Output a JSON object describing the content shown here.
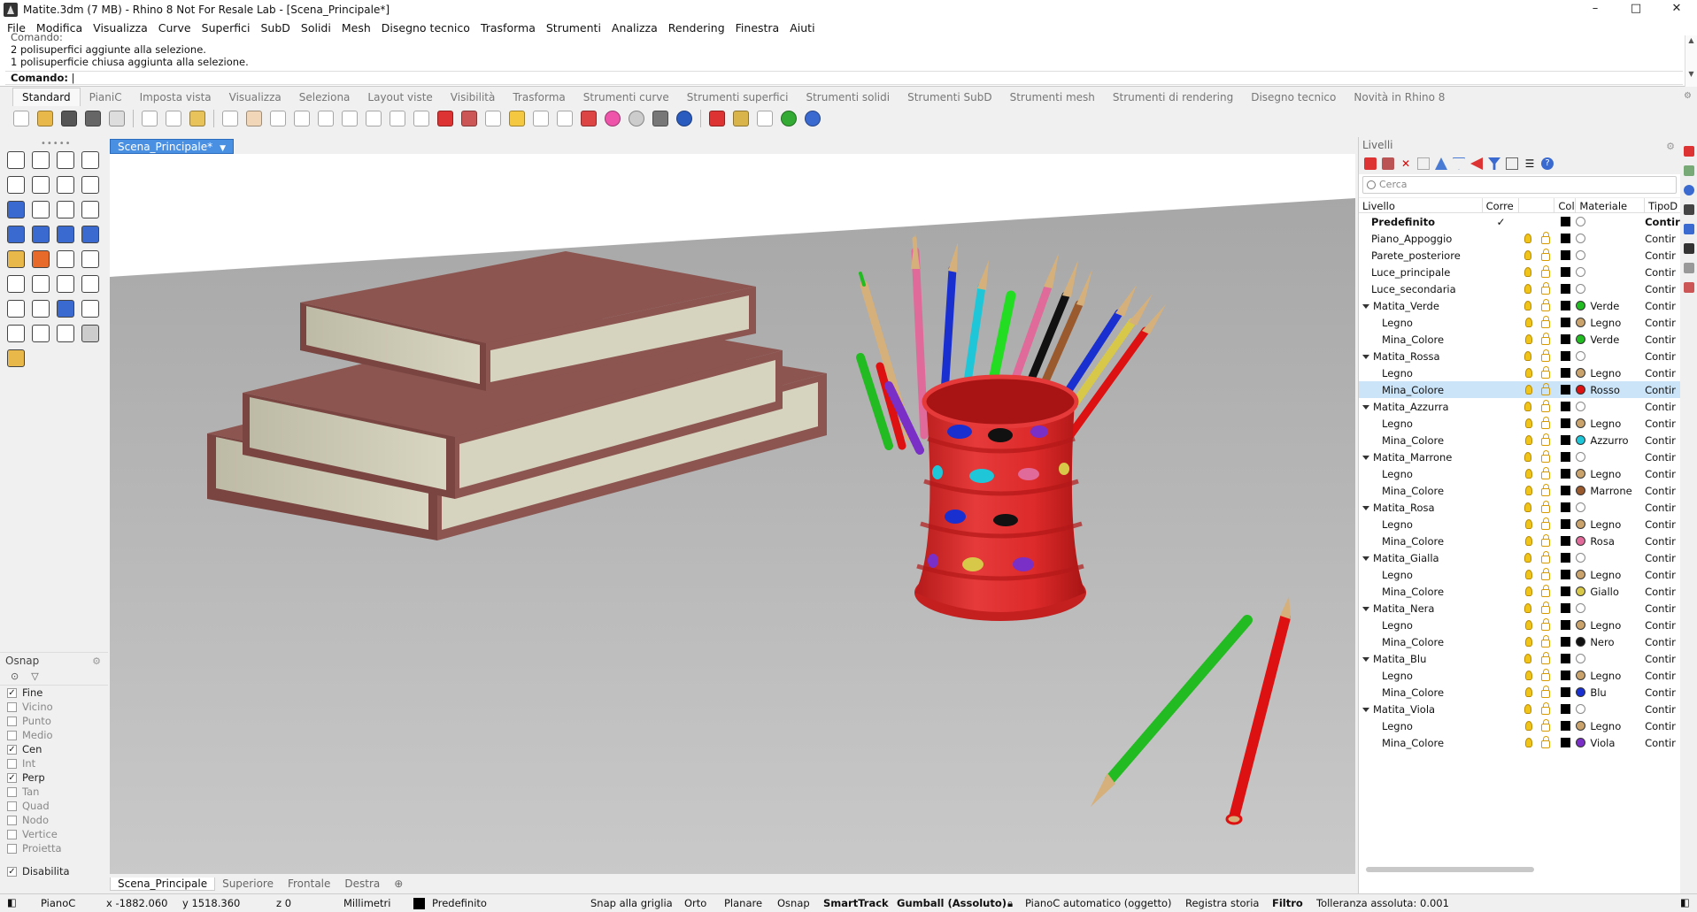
{
  "window": {
    "title": "Matite.3dm (7 MB) - Rhino 8 Not For Resale Lab - [Scena_Principale*]",
    "controls": [
      "–",
      "□",
      "✕"
    ]
  },
  "menu": [
    "File",
    "Modifica",
    "Visualizza",
    "Curve",
    "Superfici",
    "SubD",
    "Solidi",
    "Mesh",
    "Disegno tecnico",
    "Trasforma",
    "Strumenti",
    "Analizza",
    "Rendering",
    "Finestra",
    "Aiuti"
  ],
  "command": {
    "history": [
      "Comando:",
      "2 polisuperfici aggiunte alla selezione.",
      "1 polisuperficie chiusa aggiunta alla selezione."
    ],
    "prompt": "Comando:"
  },
  "toolbar_tabs": [
    "Standard",
    "PianiC",
    "Imposta vista",
    "Visualizza",
    "Seleziona",
    "Layout viste",
    "Visibilità",
    "Trasforma",
    "Strumenti curve",
    "Strumenti superfici",
    "Strumenti solidi",
    "Strumenti SubD",
    "Strumenti mesh",
    "Strumenti di rendering",
    "Disegno tecnico",
    "Novità in Rhino 8"
  ],
  "osnap": {
    "title": "Osnap",
    "items": [
      {
        "label": "Fine",
        "checked": true
      },
      {
        "label": "Vicino",
        "checked": false
      },
      {
        "label": "Punto",
        "checked": false
      },
      {
        "label": "Medio",
        "checked": false
      },
      {
        "label": "Cen",
        "checked": true
      },
      {
        "label": "Int",
        "checked": false
      },
      {
        "label": "Perp",
        "checked": true
      },
      {
        "label": "Tan",
        "checked": false
      },
      {
        "label": "Quad",
        "checked": false
      },
      {
        "label": "Nodo",
        "checked": false
      },
      {
        "label": "Vertice",
        "checked": false
      },
      {
        "label": "Proietta",
        "checked": false
      }
    ],
    "disable": {
      "label": "Disabilita",
      "checked": true
    }
  },
  "viewport": {
    "active_tab": "Scena_Principale*",
    "bottom_tabs": [
      "Scena_Principale",
      "Superiore",
      "Frontale",
      "Destra"
    ]
  },
  "layers": {
    "title": "Livelli",
    "search_placeholder": "Cerca",
    "columns": [
      "Livello",
      "Corre",
      "Colo",
      "Materiale",
      "TipoD"
    ],
    "rows": [
      {
        "name": "Predefinito",
        "indent": 0,
        "bold": true,
        "current": "✓",
        "expander": false,
        "material": "",
        "mat_color": "#ffffff",
        "type": "Contir"
      },
      {
        "name": "Piano_Appoggio",
        "indent": 0,
        "material": "",
        "mat_color": "#ffffff",
        "type": "Contir"
      },
      {
        "name": "Parete_posteriore",
        "indent": 0,
        "material": "",
        "mat_color": "#ffffff",
        "type": "Contir"
      },
      {
        "name": "Luce_principale",
        "indent": 0,
        "material": "",
        "mat_color": "#ffffff",
        "type": "Contir"
      },
      {
        "name": "Luce_secondaria",
        "indent": 0,
        "material": "",
        "mat_color": "#ffffff",
        "type": "Contir"
      },
      {
        "name": "Matita_Verde",
        "indent": 0,
        "expander": true,
        "material": "Verde",
        "mat_color": "#22bb22",
        "type": "Contir"
      },
      {
        "name": "Legno",
        "indent": 1,
        "material": "Legno",
        "mat_color": "#c9a36b",
        "type": "Contir"
      },
      {
        "name": "Mina_Colore",
        "indent": 1,
        "material": "Verde",
        "mat_color": "#22bb22",
        "type": "Contir"
      },
      {
        "name": "Matita_Rossa",
        "indent": 0,
        "expander": true,
        "material": "",
        "mat_color": "#ffffff",
        "type": "Contir"
      },
      {
        "name": "Legno",
        "indent": 1,
        "material": "Legno",
        "mat_color": "#c9a36b",
        "type": "Contir"
      },
      {
        "name": "Mina_Colore",
        "indent": 1,
        "selected": true,
        "material": "Rosso",
        "mat_color": "#dd1111",
        "type": "Contir"
      },
      {
        "name": "Matita_Azzurra",
        "indent": 0,
        "expander": true,
        "material": "",
        "mat_color": "#ffffff",
        "type": "Contir"
      },
      {
        "name": "Legno",
        "indent": 1,
        "material": "Legno",
        "mat_color": "#c9a36b",
        "type": "Contir"
      },
      {
        "name": "Mina_Colore",
        "indent": 1,
        "material": "Azzurro",
        "mat_color": "#1fc6d8",
        "type": "Contir"
      },
      {
        "name": "Matita_Marrone",
        "indent": 0,
        "expander": true,
        "material": "",
        "mat_color": "#ffffff",
        "type": "Contir"
      },
      {
        "name": "Legno",
        "indent": 1,
        "material": "Legno",
        "mat_color": "#c9a36b",
        "type": "Contir"
      },
      {
        "name": "Mina_Colore",
        "indent": 1,
        "material": "Marrone",
        "mat_color": "#9a5a2e",
        "type": "Contir"
      },
      {
        "name": "Matita_Rosa",
        "indent": 0,
        "expander": true,
        "material": "",
        "mat_color": "#ffffff",
        "type": "Contir"
      },
      {
        "name": "Legno",
        "indent": 1,
        "material": "Legno",
        "mat_color": "#c9a36b",
        "type": "Contir"
      },
      {
        "name": "Mina_Colore",
        "indent": 1,
        "material": "Rosa",
        "mat_color": "#e06a9a",
        "type": "Contir"
      },
      {
        "name": "Matita_Gialla",
        "indent": 0,
        "expander": true,
        "material": "",
        "mat_color": "#ffffff",
        "type": "Contir"
      },
      {
        "name": "Legno",
        "indent": 1,
        "material": "Legno",
        "mat_color": "#c9a36b",
        "type": "Contir"
      },
      {
        "name": "Mina_Colore",
        "indent": 1,
        "material": "Giallo",
        "mat_color": "#d8c84a",
        "type": "Contir"
      },
      {
        "name": "Matita_Nera",
        "indent": 0,
        "expander": true,
        "material": "",
        "mat_color": "#ffffff",
        "type": "Contir"
      },
      {
        "name": "Legno",
        "indent": 1,
        "material": "Legno",
        "mat_color": "#c9a36b",
        "type": "Contir"
      },
      {
        "name": "Mina_Colore",
        "indent": 1,
        "material": "Nero",
        "mat_color": "#111111",
        "type": "Contir"
      },
      {
        "name": "Matita_Blu",
        "indent": 0,
        "expander": true,
        "material": "",
        "mat_color": "#ffffff",
        "type": "Contir"
      },
      {
        "name": "Legno",
        "indent": 1,
        "material": "Legno",
        "mat_color": "#c9a36b",
        "type": "Contir"
      },
      {
        "name": "Mina_Colore",
        "indent": 1,
        "material": "Blu",
        "mat_color": "#1a2fd0",
        "type": "Contir"
      },
      {
        "name": "Matita_Viola",
        "indent": 0,
        "expander": true,
        "material": "",
        "mat_color": "#ffffff",
        "type": "Contir"
      },
      {
        "name": "Legno",
        "indent": 1,
        "material": "Legno",
        "mat_color": "#c9a36b",
        "type": "Contir"
      },
      {
        "name": "Mina_Colore",
        "indent": 1,
        "material": "Viola",
        "mat_color": "#7a2fc7",
        "type": "Contir"
      }
    ]
  },
  "statusbar": {
    "cplane": "PianoC",
    "x": "x -1882.060",
    "y": "y 1518.360",
    "z": "z 0",
    "units": "Millimetri",
    "layer": "Predefinito",
    "toggles": [
      "Snap alla griglia",
      "Orto",
      "Planare",
      "Osnap"
    ],
    "smarttrack": "SmartTrack",
    "gumball": "Gumball (Assoluto)",
    "auto_cplane": "PianoC automatico (oggetto)",
    "history": "Registra storia",
    "filter": "Filtro",
    "tolerance": "Tolleranza assoluta: 0.001"
  },
  "colors": {
    "accent": "#4a90e2",
    "book_cover": "#8c5550",
    "book_pages": "#d6d3bf",
    "holder": "#dd2a2a",
    "floor": "#b5b5b5"
  }
}
